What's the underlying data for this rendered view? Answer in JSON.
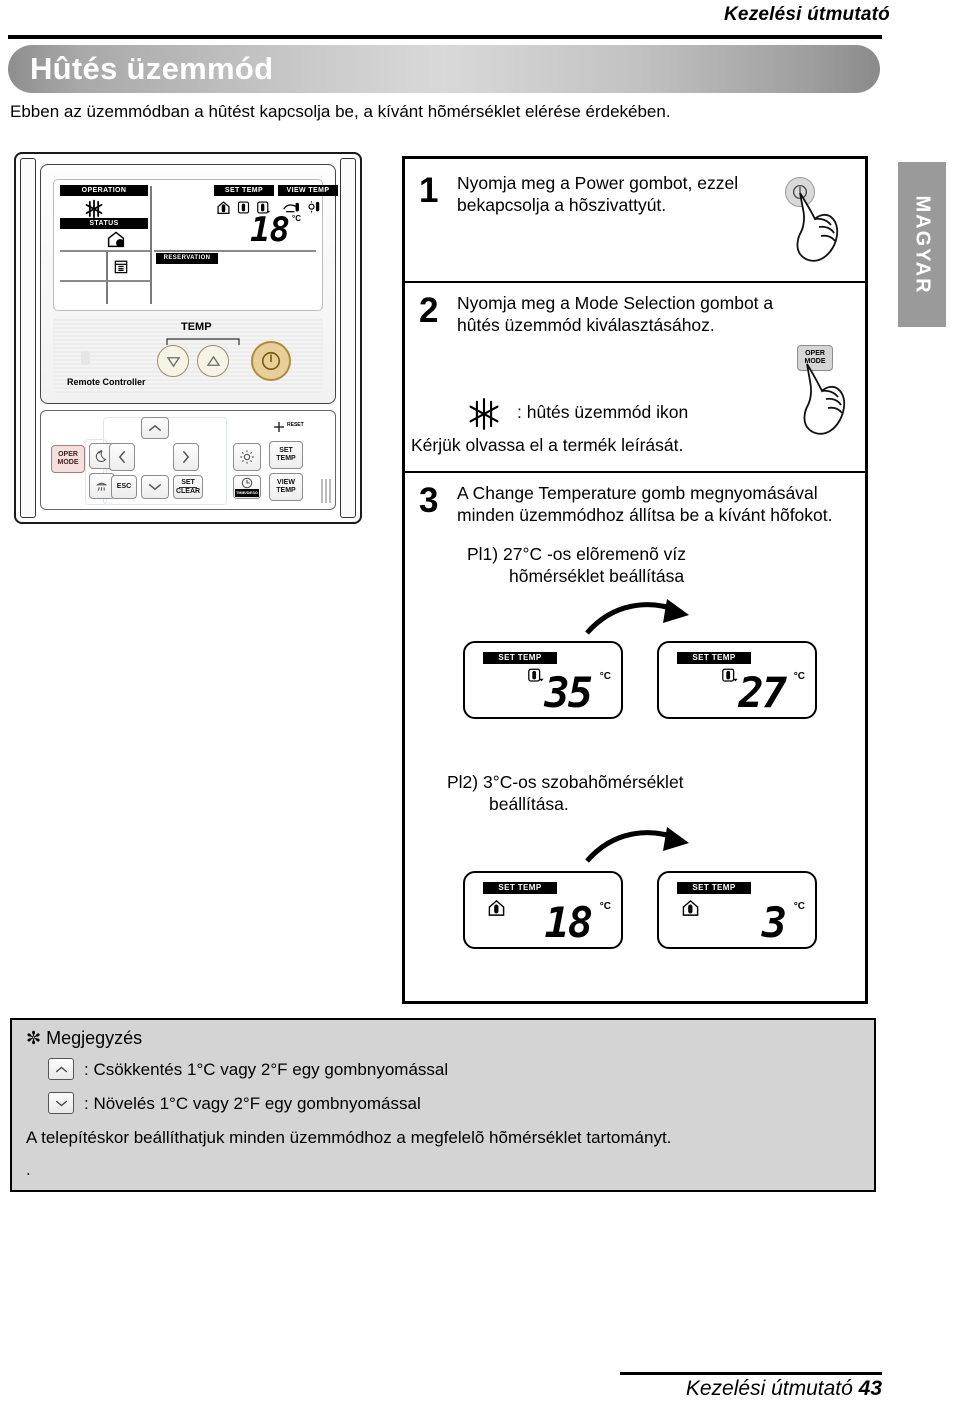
{
  "header": {
    "guide_label": "Kezelési útmutató",
    "title": "Hûtés üzemmód",
    "intro": "Ebben az üzemmódban a hûtést kapcsolja be, a kívánt hõmérséklet elérése érdekében.",
    "side_tab": "MAGYAR"
  },
  "remote": {
    "brand_label": "Remote Controller",
    "temp_label": "TEMP",
    "lcd": {
      "operation_tag": "OPERATION",
      "status_tag": "STATUS",
      "reservation_tag": "RESERVATION",
      "set_temp_tag": "SET TEMP",
      "view_temp_tag": "VIEW TEMP",
      "value": "18",
      "unit": "°C",
      "operation_icon": "snowflake-icon",
      "status_icon": "house-status-icon",
      "schedule_icon": "calendar-icon"
    },
    "buttons": {
      "oper_mode": "OPER\nMODE",
      "oper_mode_l1": "OPER",
      "oper_mode_l2": "MODE",
      "esc": "ESC",
      "set_clear_l1": "SET",
      "set_clear_l2": "CLEAR",
      "time_desg": "TIME/DESG",
      "set_temp_l1": "SET",
      "set_temp_l2": "TEMP",
      "view_temp_l1": "VIEW",
      "view_temp_l2": "TEMP",
      "reset": "RESET",
      "night_icon": "moon-icon",
      "shower_icon": "shower-icon",
      "gear_icon": "gear-icon",
      "up_icon": "chevron-up-icon",
      "down_icon": "chevron-down-icon",
      "left_icon": "chevron-left-icon",
      "right_icon": "chevron-right-icon"
    }
  },
  "steps": [
    {
      "number": "1",
      "line1": "Nyomja meg a Power gombot, ezzel",
      "line2": "bekapcsolja a hõszivattyút."
    },
    {
      "number": "2",
      "line1": "Nyomja meg a Mode Selection gombot a",
      "line2": "hûtés üzemmód kiválasztásához.",
      "icon_caption": ": hûtés üzemmód ikon",
      "note": "Kérjük olvassa el a termék leírását.",
      "button_l1": "OPER",
      "button_l2": "MODE"
    },
    {
      "number": "3",
      "line1": "A Change Temperature gomb megnyomásával",
      "line2": "minden üzemmódhoz állítsa be a kívánt hõfokot."
    }
  ],
  "examples": [
    {
      "label_l1": "Pl1)  27°C -os elõremenõ víz",
      "label_l2": "hõmérséklet beállítása",
      "icon": "water-out-thermometer-icon",
      "from": {
        "tag": "SET TEMP",
        "value": "35",
        "unit": "°C"
      },
      "to": {
        "tag": "SET TEMP",
        "value": "27",
        "unit": "°C"
      }
    },
    {
      "label_l1": "Pl2) 3°C-os szobahõmérséklet",
      "label_l2": "beállítása.",
      "icon": "house-thermometer-icon",
      "from": {
        "tag": "SET TEMP",
        "value": "18",
        "unit": "°C"
      },
      "to": {
        "tag": "SET TEMP",
        "value": "3",
        "unit": "°C"
      }
    }
  ],
  "notes": {
    "title": "✼ Megjegyzés",
    "items": [
      {
        "icon": "chevron-up-icon",
        "text": ": Csökkentés 1°C vagy 2°F egy gombnyomással"
      },
      {
        "icon": "chevron-down-icon",
        "text": ": Növelés 1°C vagy 2°F egy gombnyomással"
      }
    ],
    "line3": "A telepítéskor beállíthatjuk minden üzemmódhoz a megfelelõ hõmérséklet tartományt.",
    "line4": "."
  },
  "footer": {
    "text": "Kezelési útmutató",
    "page": "43"
  }
}
